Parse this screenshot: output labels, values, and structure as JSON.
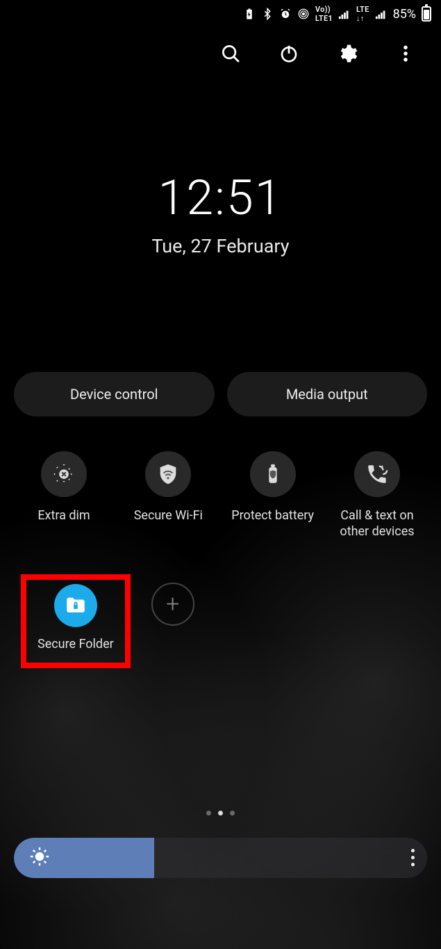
{
  "status": {
    "battery_pct": "85%"
  },
  "clock": {
    "time": "12:51",
    "date": "Tue, 27 February"
  },
  "pills": {
    "device_control": "Device control",
    "media_output": "Media output"
  },
  "qs": {
    "extra_dim": "Extra dim",
    "secure_wifi": "Secure Wi-Fi",
    "protect_battery": "Protect battery",
    "call_text": "Call & text on other devices",
    "secure_folder": "Secure Folder"
  },
  "brightness": {
    "value_pct": 34
  }
}
